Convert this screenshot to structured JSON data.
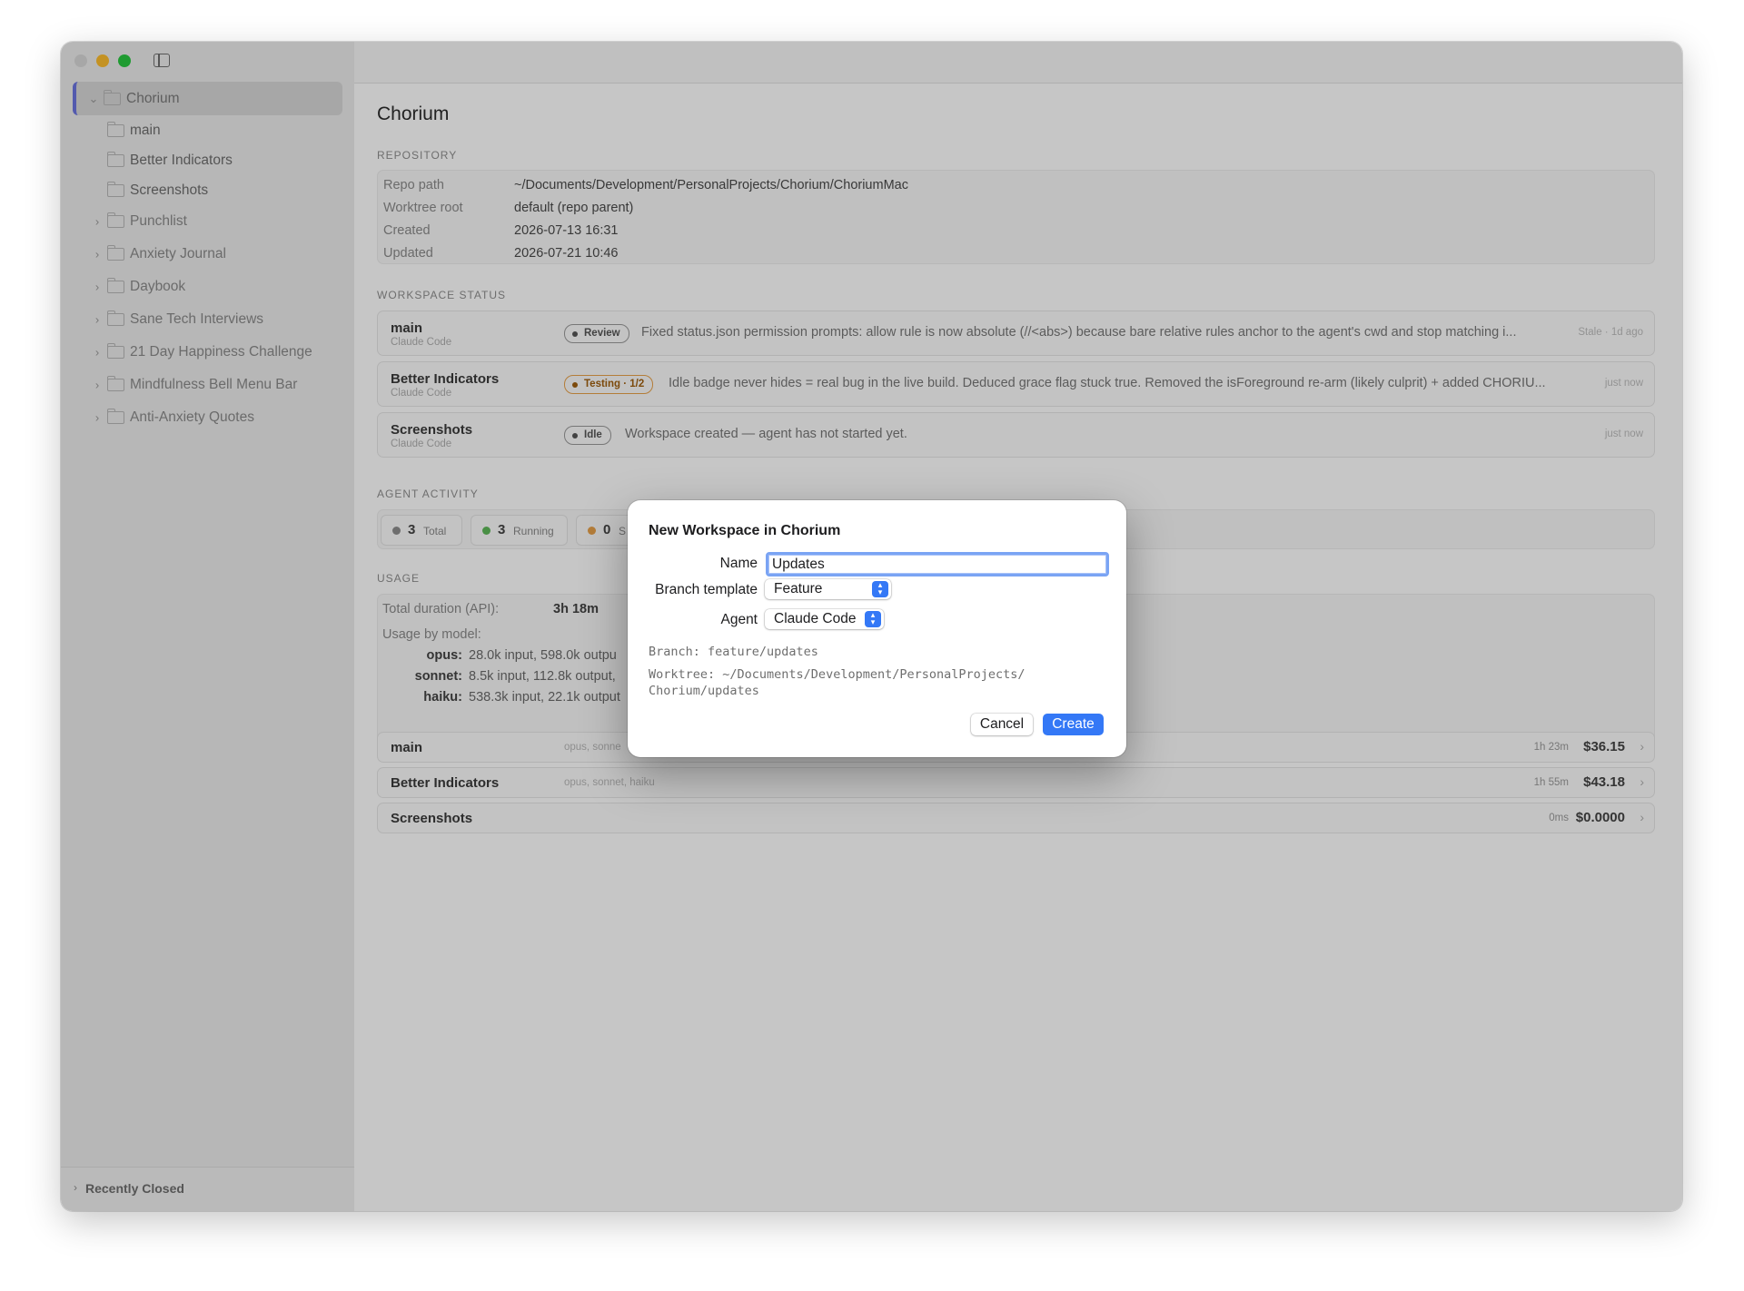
{
  "sidebar": {
    "tree": [
      {
        "label": "Chorium",
        "expanded": true,
        "selected": true,
        "children": [
          {
            "label": "main"
          },
          {
            "label": "Better Indicators"
          },
          {
            "label": "Screenshots"
          }
        ]
      },
      {
        "label": "Punchlist"
      },
      {
        "label": "Anxiety Journal"
      },
      {
        "label": "Daybook"
      },
      {
        "label": "Sane Tech Interviews"
      },
      {
        "label": "21 Day Happiness Challenge"
      },
      {
        "label": "Mindfulness Bell Menu Bar"
      },
      {
        "label": "Anti-Anxiety Quotes"
      }
    ],
    "recently_closed": "Recently Closed"
  },
  "main": {
    "title": "Chorium",
    "repository": {
      "heading": "REPOSITORY",
      "rows": [
        {
          "key": "Repo path",
          "value": "~/Documents/Development/PersonalProjects/Chorium/ChoriumMac"
        },
        {
          "key": "Worktree root",
          "value": "default (repo parent)"
        },
        {
          "key": "Created",
          "value": "2026-07-13 16:31"
        },
        {
          "key": "Updated",
          "value": "2026-07-21 10:46"
        }
      ]
    },
    "workspace_status": {
      "heading": "WORKSPACE STATUS",
      "rows": [
        {
          "name": "main",
          "agent": "Claude Code",
          "badge": "Review",
          "message": "Fixed status.json permission prompts: allow rule is now absolute (//<abs>) because bare relative rules anchor to the agent's cwd and stop matching i...",
          "time": "Stale · 1d ago"
        },
        {
          "name": "Better Indicators",
          "agent": "Claude Code",
          "badge": "Testing · 1/2",
          "message": "Idle badge never hides = real bug in the live build. Deduced grace flag stuck true. Removed the isForeground re-arm (likely culprit) + added CHORIU...",
          "time": "just now"
        },
        {
          "name": "Screenshots",
          "agent": "Claude Code",
          "badge": "Idle",
          "message": "Workspace created — agent has not started yet.",
          "time": "just now"
        }
      ]
    },
    "agent_activity": {
      "heading": "AGENT ACTIVITY",
      "pills": [
        {
          "count": "3",
          "label": "Total",
          "color": "#8e8e8e"
        },
        {
          "count": "3",
          "label": "Running",
          "color": "#5fb85a"
        },
        {
          "count": "0",
          "label": "S",
          "color": "#e8a24a"
        }
      ]
    },
    "usage": {
      "heading": "USAGE",
      "total_label": "Total duration (API):",
      "total_value": "3h 18m",
      "by_model_label": "Usage by model:",
      "models": [
        {
          "name": "opus:",
          "value": "28.0k input, 598.0k outpu"
        },
        {
          "name": "sonnet:",
          "value": "8.5k input, 112.8k output,"
        },
        {
          "name": "haiku:",
          "value": "538.3k input, 22.1k output"
        }
      ],
      "rows": [
        {
          "name": "main",
          "models": "opus, sonne",
          "duration": "1h 23m",
          "cost": "$36.15"
        },
        {
          "name": "Better Indicators",
          "models": "opus, sonnet, haiku",
          "duration": "1h 55m",
          "cost": "$43.18"
        },
        {
          "name": "Screenshots",
          "models": "",
          "duration": "0ms",
          "cost": "$0.0000"
        }
      ]
    }
  },
  "dialog": {
    "title": "New Workspace in Chorium",
    "name_label": "Name",
    "name_value": "Updates",
    "branch_template_label": "Branch template",
    "branch_template_value": "Feature",
    "agent_label": "Agent",
    "agent_value": "Claude Code",
    "branch_preview": "Branch: feature/updates",
    "worktree_preview_line1": "Worktree: ~/Documents/Development/PersonalProjects/",
    "worktree_preview_line2": "Chorium/updates",
    "cancel_label": "Cancel",
    "create_label": "Create"
  },
  "colors": {
    "accent": "#3478f6",
    "focus_ring": "#7aa4f4",
    "selection_bar": "#6b74e0",
    "testing": "#e8a24a"
  }
}
